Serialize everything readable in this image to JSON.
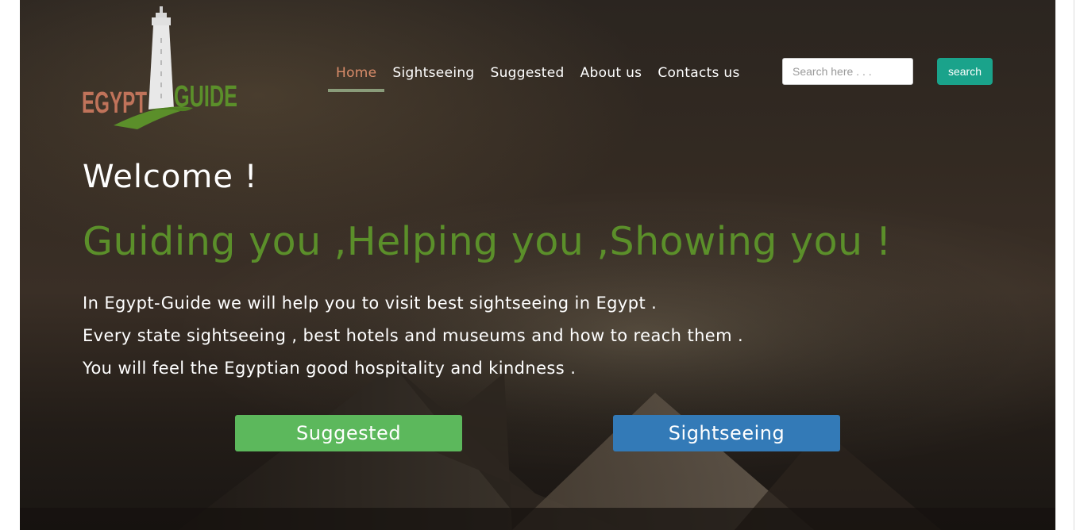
{
  "logo": {
    "left_text": "EGYPT",
    "right_text": "GUIDE",
    "icon": "lighthouse-icon"
  },
  "nav": {
    "items": [
      {
        "label": "Home",
        "active": true
      },
      {
        "label": "Sightseeing",
        "active": false
      },
      {
        "label": "Suggested",
        "active": false
      },
      {
        "label": "About us",
        "active": false
      },
      {
        "label": "Contacts us",
        "active": false
      }
    ]
  },
  "search": {
    "placeholder": "Search here . . .",
    "value": "",
    "button_label": "search"
  },
  "hero": {
    "welcome": "Welcome !",
    "tagline": "Guiding you ,Helping you ,Showing you !",
    "lines": [
      "In Egypt-Guide we will help you to visit best sightseeing in Egypt .",
      "Every state sightseeing , best hotels and museums and how to reach them .",
      "You will feel the Egyptian good hospitality and kindness ."
    ]
  },
  "cta": {
    "suggested_label": "Suggested",
    "sightseeing_label": "Sightseeing"
  },
  "colors": {
    "nav_active": "#d98c6a",
    "tagline": "#5b8f2a",
    "search_button": "#1aa38b",
    "suggested_button": "#5cb85c",
    "sightseeing_button": "#337ab7"
  }
}
